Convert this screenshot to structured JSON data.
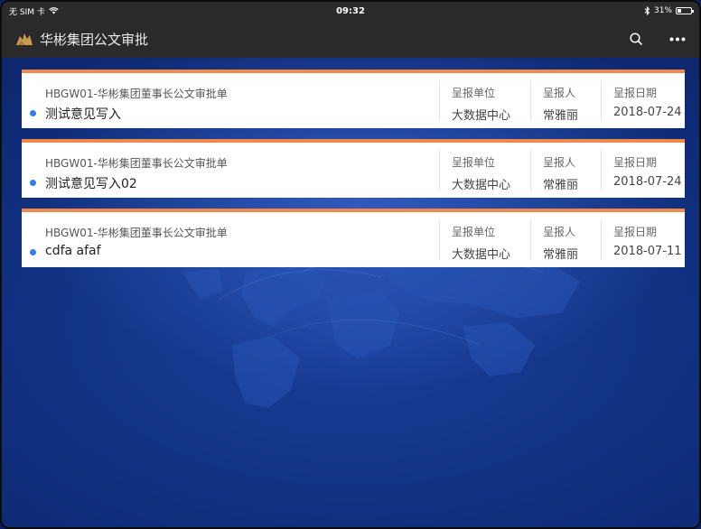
{
  "status_bar": {
    "carrier": "无 SIM 卡",
    "time": "09:32",
    "battery": "31%",
    "battery_level": 0.31
  },
  "nav": {
    "title": "华彬集团公文审批",
    "search_icon": "search-icon",
    "more_icon": "more-icon"
  },
  "colors": {
    "accent_border": "#f08a4b",
    "unread_dot": "#2f7ff0",
    "navbar_bg": "#2a2a2a"
  },
  "columns": {
    "unit_label": "呈报单位",
    "person_label": "呈报人",
    "date_label": "呈报日期"
  },
  "items": [
    {
      "form": "HBGW01-华彬集团董事长公文审批单",
      "subject": "测试意见写入",
      "unit": "大数据中心",
      "person": "常雅丽",
      "date": "2018-07-24"
    },
    {
      "form": "HBGW01-华彬集团董事长公文审批单",
      "subject": "测试意见写入02",
      "unit": "大数据中心",
      "person": "常雅丽",
      "date": "2018-07-24"
    },
    {
      "form": "HBGW01-华彬集团董事长公文审批单",
      "subject": "cdfa afaf",
      "unit": "大数据中心",
      "person": "常雅丽",
      "date": "2018-07-11"
    }
  ]
}
